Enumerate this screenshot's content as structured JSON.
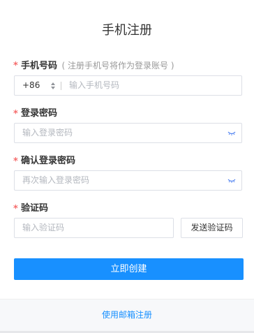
{
  "page": {
    "title": "手机注册"
  },
  "phone": {
    "label": "手机号码",
    "hint": "( 注册手机号将作为登录账号 )",
    "country_code": "+86",
    "placeholder": "输入手机号码"
  },
  "password": {
    "label": "登录密码",
    "placeholder": "输入登录密码"
  },
  "confirm": {
    "label": "确认登录密码",
    "placeholder": "再次输入登录密码"
  },
  "code": {
    "label": "验证码",
    "placeholder": "输入验证码",
    "send_label": "发送验证码"
  },
  "actions": {
    "submit_label": "立即创建",
    "email_register_label": "使用邮箱注册"
  },
  "required_marker": "*",
  "colors": {
    "primary": "#1890ff",
    "required": "#f56c6c",
    "eye_icon": "#4a7ef0"
  }
}
